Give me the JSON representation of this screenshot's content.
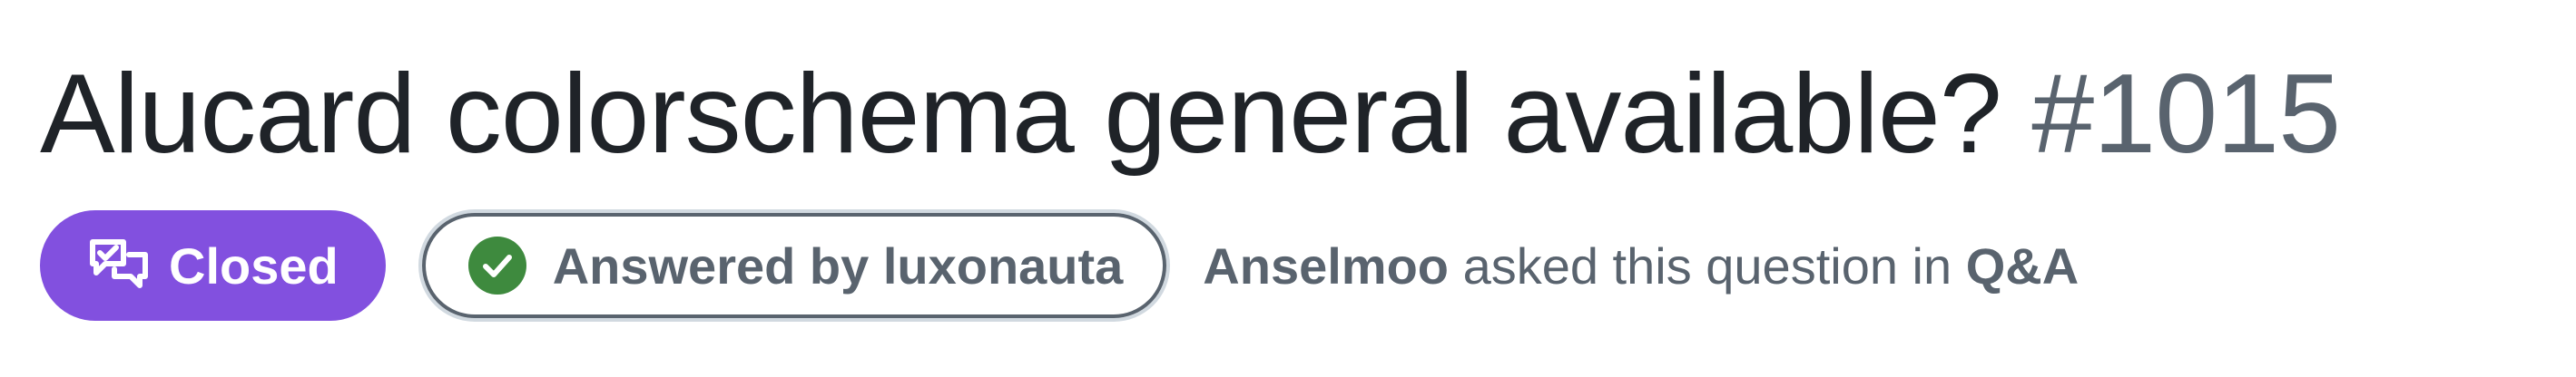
{
  "discussion": {
    "title": "Alucard colorschema general available?",
    "number": "#1015"
  },
  "state_badge": {
    "label": "Closed",
    "icon": "discussion-closed-icon",
    "color": "#8250df"
  },
  "answered_badge": {
    "prefix": "Answered by",
    "user": "luxonauta",
    "icon": "check-circle-icon",
    "icon_color": "#3e8a3e"
  },
  "asked": {
    "author": "Anselmoo",
    "middle": "asked this question in",
    "category": "Q&A"
  }
}
